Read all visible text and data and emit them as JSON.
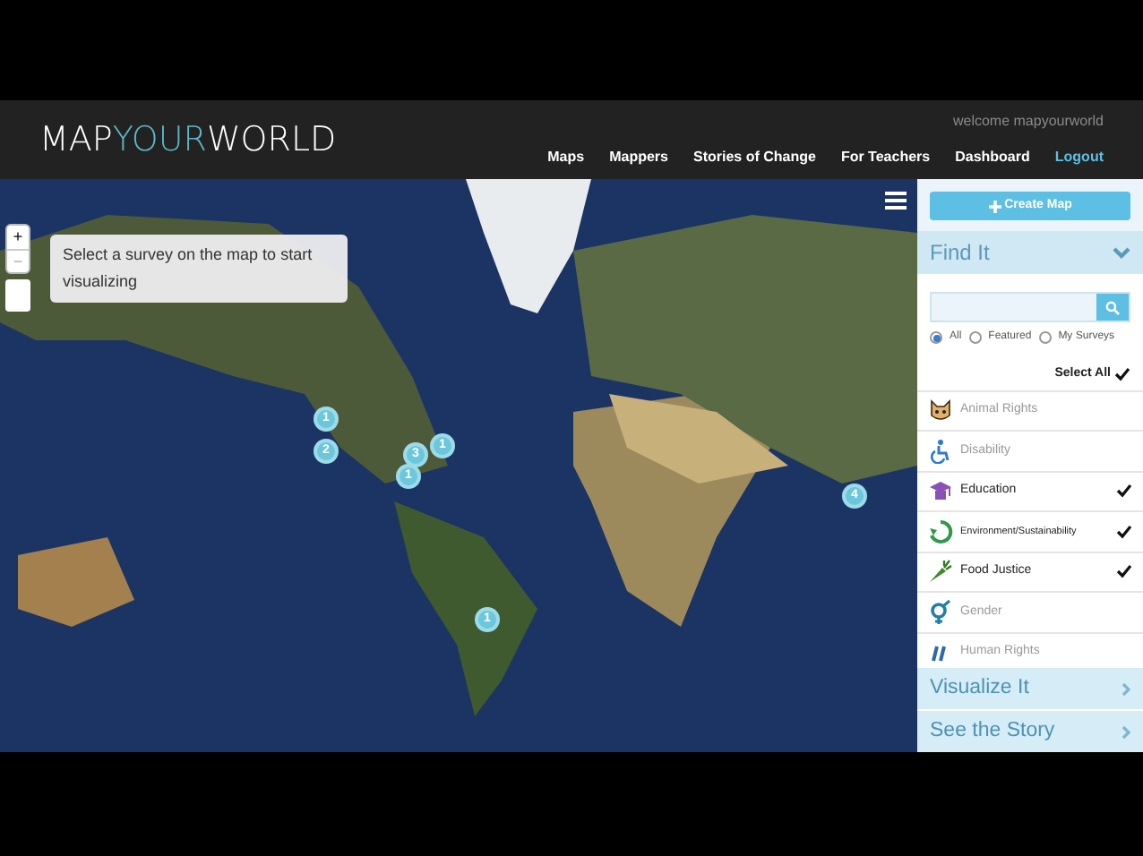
{
  "header": {
    "logo": [
      {
        "text": "MAP",
        "highlight": false
      },
      {
        "text": "YOUR",
        "highlight": true
      },
      {
        "text": "WORLD",
        "highlight": false
      }
    ],
    "welcome": "welcome mapyourworld",
    "nav": [
      {
        "label": "Maps",
        "kind": "link"
      },
      {
        "label": "Mappers",
        "kind": "link"
      },
      {
        "label": "Stories of Change",
        "kind": "link"
      },
      {
        "label": "For Teachers",
        "kind": "link"
      },
      {
        "label": "Dashboard",
        "kind": "link"
      },
      {
        "label": "Logout",
        "kind": "accent"
      }
    ]
  },
  "map": {
    "zoom_in": "+",
    "zoom_out": "−",
    "tooltip": "Select a survey on the map to start visualizing",
    "markers": [
      {
        "count": "1"
      },
      {
        "count": "2"
      },
      {
        "count": "3"
      },
      {
        "count": "1"
      },
      {
        "count": "1"
      },
      {
        "count": "4"
      },
      {
        "count": "1"
      }
    ]
  },
  "sidebar": {
    "create_button": "Create Map",
    "find_title": "Find It",
    "expanded": true,
    "filters": [
      {
        "label": "All",
        "selected": true
      },
      {
        "label": "Featured",
        "selected": false
      },
      {
        "label": "My Surveys",
        "selected": false
      }
    ],
    "select_all": "Select All",
    "categories": [
      {
        "label": "Animal Rights",
        "checked": false,
        "kind": "cat"
      },
      {
        "label": "Disability",
        "checked": false,
        "kind": "wheelchair"
      },
      {
        "label": "Education",
        "checked": true,
        "kind": "cap"
      },
      {
        "label": "Environment/Sustainability",
        "checked": true,
        "kind": "recycle"
      },
      {
        "label": "Food Justice",
        "checked": true,
        "kind": "carrot"
      },
      {
        "label": "Gender",
        "checked": false,
        "kind": "gender"
      },
      {
        "label": "Human Rights",
        "checked": false,
        "kind": "hands"
      }
    ],
    "panels": [
      {
        "label": "Visualize It"
      },
      {
        "label": "See the Story"
      }
    ]
  }
}
